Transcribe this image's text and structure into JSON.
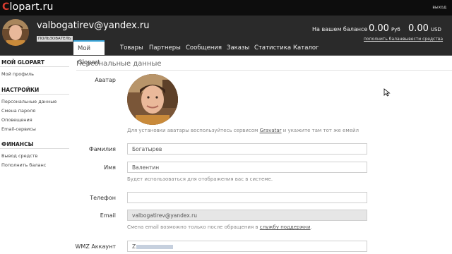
{
  "topbar": {
    "logo_first": "C",
    "logo_rest": "lopart.ru",
    "logout": "выход"
  },
  "header": {
    "username": "valbogatirev@yandex.ru",
    "role": "ПОЛЬЗОВАТЕЛЬ",
    "balance_label": "На вашем балансе",
    "balance_rub": "0.00",
    "balance_rub_cur": "Руб",
    "balance_usd": "0.00",
    "balance_usd_cur": "USD",
    "topup_link": "пополнить баланс",
    "withdraw_link": "вывести средства"
  },
  "nav": {
    "tabs": [
      "Мой Glopart",
      "Товары",
      "Партнеры",
      "Сообщения",
      "Заказы",
      "Статистика",
      "Каталог"
    ]
  },
  "sidebar": {
    "section1": "МОЙ GLOPART",
    "my_profile": "Мой профиль",
    "section2": "НАСТРОЙКИ",
    "settings": [
      "Персональные данные",
      "Смена пароля",
      "Оповещения",
      "Email-сервисы"
    ],
    "section3": "ФИНАНСЫ",
    "finance": [
      "Вывод средств",
      "Пополнить баланс"
    ]
  },
  "form": {
    "title": "Персональные данные",
    "avatar_label": "Аватар",
    "avatar_hint_pre": "Для установки аватары воспользуйтесь сервисом ",
    "avatar_hint_link": "Gravatar",
    "avatar_hint_post": " и укажите там тот же емейл",
    "lastname_label": "Фамилия",
    "lastname_value": "Богатырев",
    "firstname_label": "Имя",
    "firstname_value": "Валентин",
    "name_hint": "Будет использоваться для отображения вас в системе.",
    "phone_label": "Телефон",
    "phone_value": "",
    "email_label": "Email",
    "email_value": "valbogatirev@yandex.ru",
    "email_hint_pre": "Смена email возможно только после обращения в ",
    "email_hint_link": "службу поддержки",
    "email_hint_post": ".",
    "wmz_label": "WMZ Аккаунт",
    "wmz_value": "Z"
  },
  "colors": {
    "accent": "#3aa5d9",
    "logo_c": "#d63b2f",
    "header_bg": "#2a2a2a",
    "topbar_bg": "#0d0d0d"
  }
}
